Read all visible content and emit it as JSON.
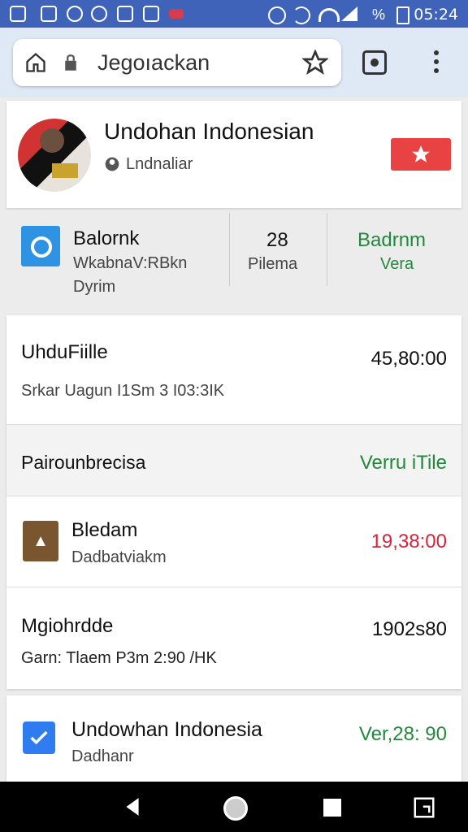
{
  "status": {
    "time": "05:24"
  },
  "browser": {
    "url": "Jegoıackan"
  },
  "header": {
    "title": "Undohan Indonesian",
    "subtitle": "Lndnaliar"
  },
  "summary": {
    "left_title": "Balornk",
    "left_line1": "WkabnaV:RBkn",
    "left_line2": "Dyrim",
    "middle_value": "28",
    "middle_label": "Pilema",
    "right_value": "Baԁrnm",
    "right_label": "Vera"
  },
  "list": {
    "items": [
      {
        "title": "UhduFiille",
        "subtitle": "Srkar Uagun I1Sm 3 I03:3IK",
        "value": "45,80:00"
      },
      {
        "title": "Pairounbrecisa",
        "value": "Verru iTile"
      },
      {
        "title": "Bledam",
        "subtitle": "Dadbatviakm",
        "value": "19,38:00"
      },
      {
        "title": "Mgiohrdde",
        "subtitle": "Garn: Tlaem P3m 2:90 /HK",
        "value": "1902s80"
      }
    ]
  },
  "bottom_item": {
    "title": "Undowhan Indonesia",
    "subtitle": "Dadhanr",
    "value": "Ver,28: 90"
  }
}
